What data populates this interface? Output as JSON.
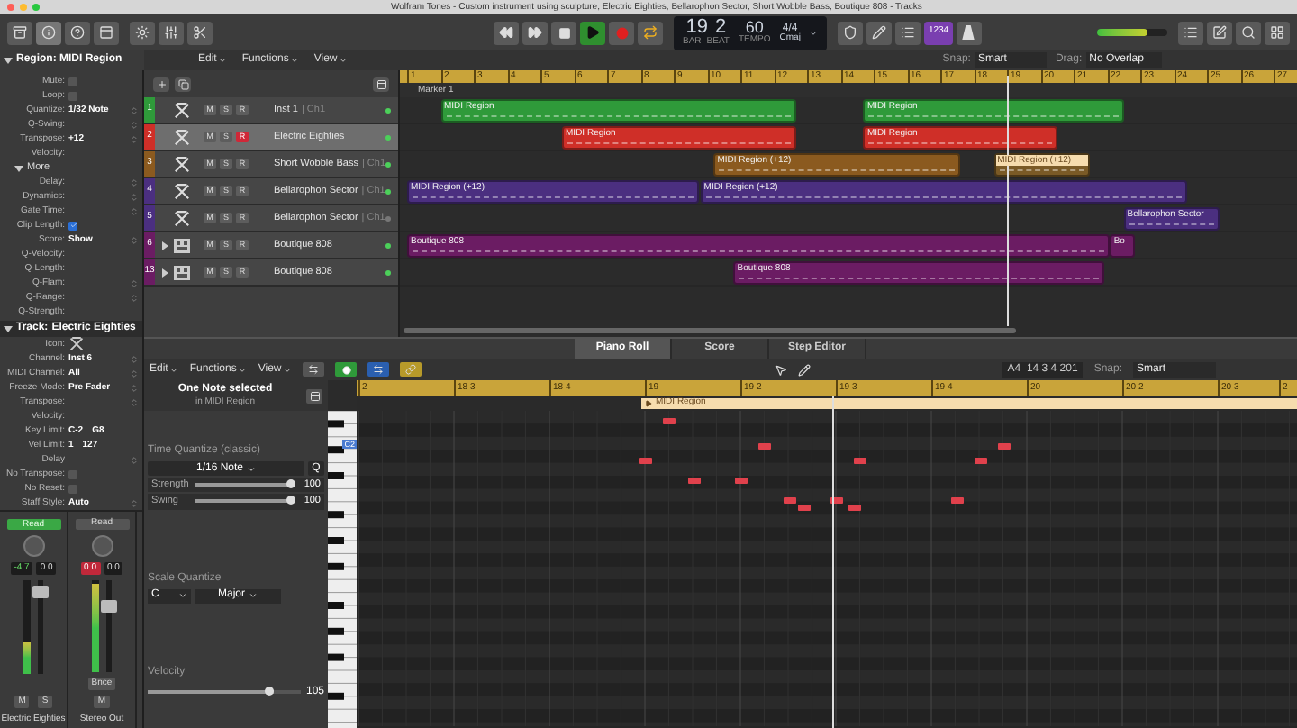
{
  "window": {
    "title": "Wolfram Tones - Custom instrument using sculpture, Electric Eighties, Bellarophon Sector, Short Wobble Bass, Boutique 808 - Tracks"
  },
  "toolbar": {
    "playing": true,
    "cycle": true,
    "bar": "19",
    "beat": "2",
    "bar_label": "BAR",
    "beat_label": "BEAT",
    "tempo": "60",
    "tempo_label": "TEMPO",
    "signature": "4/4",
    "key": "Cmaj",
    "count_in": "1234",
    "master_volume": {
      "level": 0.72
    }
  },
  "tracks_bar": {
    "region_label": "Region: MIDI Region",
    "menus": [
      "Edit",
      "Functions",
      "View"
    ],
    "snap_label": "Snap:",
    "snap": "Smart",
    "drag_label": "Drag:",
    "drag": "No Overlap"
  },
  "ruler": [
    "1",
    "2",
    "3",
    "4",
    "5",
    "6",
    "7",
    "8",
    "9",
    "10",
    "11",
    "12",
    "13",
    "14",
    "15",
    "16",
    "17",
    "18",
    "19",
    "20",
    "21",
    "22",
    "23",
    "24",
    "25",
    "26",
    "27"
  ],
  "marker": "Marker 1",
  "tracks": [
    {
      "number": "1",
      "color": "#2f9a3a",
      "kind": "instrument",
      "name": "Inst 1",
      "channel": "| Ch1",
      "selected": false,
      "record": false,
      "active": true,
      "buttons": [
        "M",
        "S",
        "R"
      ],
      "regions": [
        {
          "label": "MIDI Region",
          "selected": false
        },
        {
          "label": "MIDI Region",
          "selected": false
        }
      ]
    },
    {
      "number": "2",
      "color": "#cf2f28",
      "kind": "instrument",
      "name": "Electric Eighties",
      "selected": true,
      "record": true,
      "active": true,
      "buttons": [
        "M",
        "S",
        "R"
      ],
      "regions": [
        {
          "label": "MIDI Region",
          "selected": false
        },
        {
          "label": "MIDI Region",
          "selected": false
        }
      ]
    },
    {
      "number": "3",
      "color": "#8b5a1f",
      "kind": "instrument",
      "name": "Short Wobble Bass",
      "channel": "| Ch1",
      "selected": false,
      "record": false,
      "active": true,
      "buttons": [
        "M",
        "S",
        "R"
      ],
      "regions": [
        {
          "label": "MIDI Region (+12)",
          "selected": false
        },
        {
          "label": "MIDI Region (+12)",
          "selected": true
        }
      ]
    },
    {
      "number": "4",
      "color": "#4b2f80",
      "kind": "instrument",
      "name": "Bellarophon Sector",
      "channel": "| Ch1",
      "selected": false,
      "record": false,
      "active": true,
      "buttons": [
        "M",
        "S",
        "R"
      ],
      "regions": [
        {
          "label": "MIDI Region (+12)",
          "selected": false
        },
        {
          "label": "MIDI Region (+12)",
          "selected": false
        }
      ]
    },
    {
      "number": "5",
      "color": "#4b2f80",
      "kind": "instrument",
      "name": "Bellarophon Sector",
      "channel": "| Ch1",
      "selected": false,
      "record": false,
      "active": false,
      "buttons": [
        "M",
        "S",
        "R"
      ],
      "regions": [
        {
          "label": "Bellarophon Sector",
          "selected": false
        }
      ]
    },
    {
      "number": "6",
      "color": "#6b1c63",
      "kind": "drummer",
      "name": "Boutique 808",
      "selected": false,
      "record": false,
      "active": true,
      "buttons": [
        "M",
        "S",
        "R"
      ],
      "regions": [
        {
          "label": "Boutique 808",
          "selected": false
        },
        {
          "label": "Bo",
          "selected": false
        }
      ]
    },
    {
      "number": "13",
      "color": "#6b1c63",
      "kind": "drummer",
      "name": "Boutique 808",
      "selected": false,
      "record": false,
      "active": true,
      "buttons": [
        "M",
        "S",
        "R"
      ],
      "regions": [
        {
          "label": "Boutique 808",
          "selected": false
        }
      ]
    }
  ],
  "inspector": {
    "region_rows": [
      {
        "kind": "checkbox",
        "label": "Mute:",
        "checked": false
      },
      {
        "kind": "checkbox",
        "label": "Loop:",
        "checked": false
      },
      {
        "kind": "popup",
        "label": "Quantize:",
        "value": "1/32 Note"
      },
      {
        "kind": "popup",
        "label": "Q-Swing:"
      },
      {
        "kind": "popup",
        "label": "Transpose:",
        "value": "+12"
      },
      {
        "kind": "text",
        "label": "Velocity:"
      }
    ],
    "more": {
      "label": "More",
      "expanded": true
    },
    "more_rows": [
      {
        "kind": "popup",
        "label": "Delay:"
      },
      {
        "kind": "popup",
        "label": "Dynamics:"
      },
      {
        "kind": "popup",
        "label": "Gate Time:"
      },
      {
        "kind": "checkbox",
        "label": "Clip Length:",
        "checked": true
      },
      {
        "kind": "popup",
        "label": "Score:",
        "value": "Show"
      },
      {
        "kind": "text",
        "label": "Q-Velocity:"
      },
      {
        "kind": "text",
        "label": "Q-Length:"
      },
      {
        "kind": "popup",
        "label": "Q-Flam:"
      },
      {
        "kind": "popup",
        "label": "Q-Range:"
      },
      {
        "kind": "text",
        "label": "Q-Strength:"
      }
    ],
    "track_header": {
      "label": "Track:",
      "name": "Electric Eighties",
      "expanded": true
    },
    "track_rows": [
      {
        "kind": "icon",
        "label": "Icon:"
      },
      {
        "kind": "popup",
        "label": "Channel:",
        "value": "Inst 6"
      },
      {
        "kind": "popup",
        "label": "MIDI Channel:",
        "value": "All"
      },
      {
        "kind": "popup",
        "label": "Freeze Mode:",
        "value": "Pre Fader"
      },
      {
        "kind": "popup",
        "label": "Transpose:"
      },
      {
        "kind": "text",
        "label": "Velocity:"
      },
      {
        "kind": "text",
        "label": "Key Limit:",
        "value": "C-2",
        "value2": "G8"
      },
      {
        "kind": "text",
        "label": "Vel Limit:",
        "value": "1",
        "value2": "127"
      },
      {
        "kind": "popup",
        "label": "Delay"
      },
      {
        "kind": "checkbox",
        "label": "No Transpose:",
        "checked": false
      },
      {
        "kind": "checkbox",
        "label": "No Reset:",
        "checked": false
      },
      {
        "kind": "popup",
        "label": "Staff Style:",
        "value": "Auto"
      }
    ]
  },
  "strips": [
    {
      "automation": "Read",
      "peak": "-4.7",
      "peak_clip": false,
      "volume": "0.0",
      "meter": {
        "level": 0.35
      },
      "fader": {
        "level": 0.88
      },
      "buttons": [
        "M",
        "S"
      ],
      "name": "Electric Eighties"
    },
    {
      "automation": "Read",
      "peak": "0.0",
      "peak_clip": true,
      "volume": "0.0",
      "meter": {
        "level": 0.95
      },
      "fader": {
        "level": 0.7
      },
      "bounce": "Bnce",
      "buttons": [
        "M"
      ],
      "name": "Stereo Out"
    }
  ],
  "editor_tabs": [
    {
      "label": "Piano Roll",
      "selected": true
    },
    {
      "label": "Score",
      "selected": false
    },
    {
      "label": "Step Editor",
      "selected": false
    }
  ],
  "piano_roll": {
    "menus": [
      "Edit",
      "Functions",
      "View"
    ],
    "position": "A4  14 3 4 201",
    "snap_label": "Snap:",
    "snap": "Smart",
    "info_title": "One Note selected",
    "info_sub": "in MIDI Region",
    "key_label": "C2",
    "time_quantize": {
      "label": "Time Quantize (classic)",
      "value": "1/16 Note",
      "q": "Q",
      "strength_label": "Strength",
      "strength": "100",
      "strength_slider": {
        "level": 1
      },
      "swing_label": "Swing",
      "swing": "100",
      "swing_slider": {
        "level": 1
      }
    },
    "scale_quantize": {
      "label": "Scale Quantize",
      "root": "C",
      "scale": "Major"
    },
    "velocity": {
      "label": "Velocity",
      "value": "105",
      "level": 0.82
    },
    "ruler": [
      "2",
      "18 3",
      "18 4",
      "19",
      "19 2",
      "19 3",
      "19 4",
      "20",
      "20 2",
      "20 3",
      "2"
    ],
    "region_label": "MIDI Region"
  }
}
